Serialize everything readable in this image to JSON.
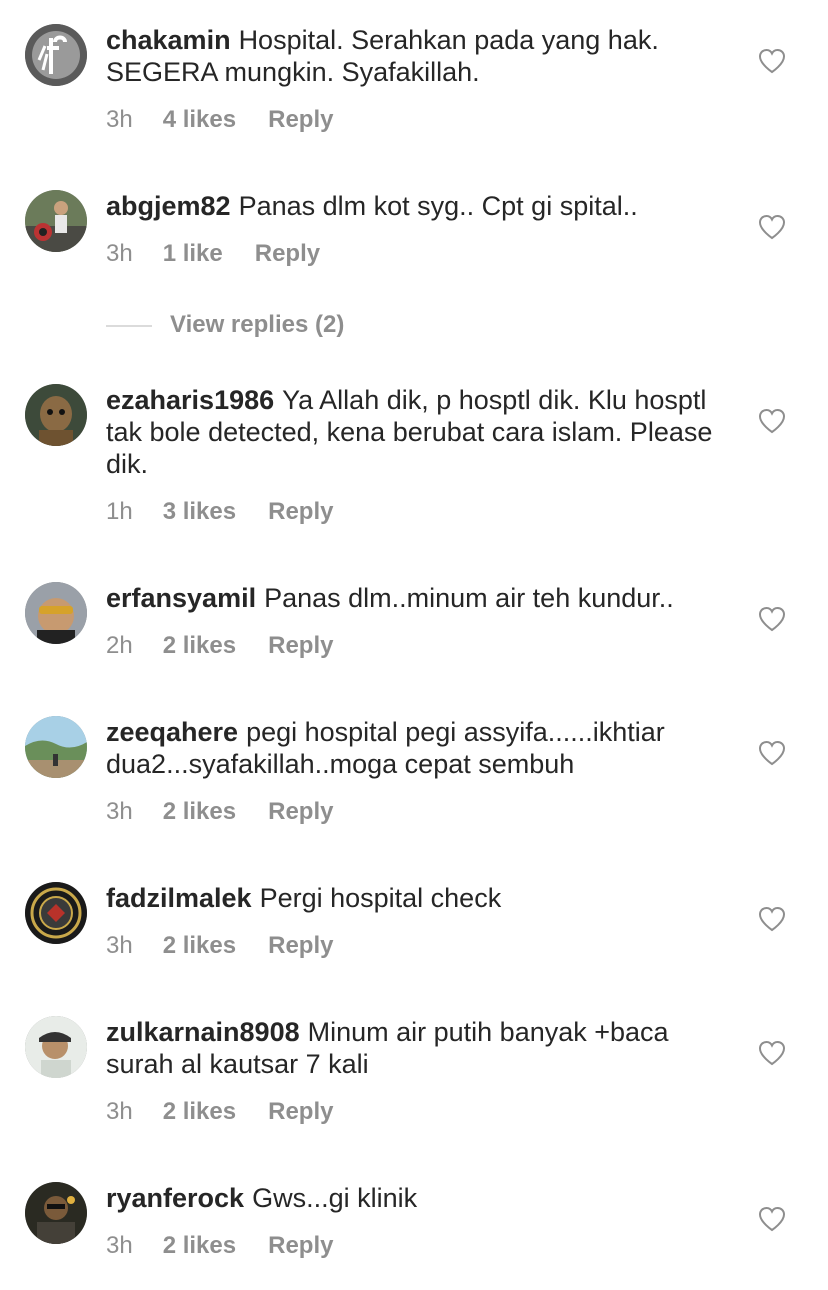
{
  "comments": [
    {
      "username": "chakamin",
      "text": "Hospital. Serahkan pada yang hak. SEGERA mungkin. Syafakillah.",
      "time": "3h",
      "likes": "4 likes",
      "reply": "Reply"
    },
    {
      "username": "abgjem82",
      "text": "Panas dlm kot syg.. Cpt gi spital..",
      "time": "3h",
      "likes": "1 like",
      "reply": "Reply"
    },
    {
      "username": "ezaharis1986",
      "text": "Ya Allah dik, p hosptl dik. Klu hosptl tak bole detected, kena berubat cara islam. Please dik.",
      "time": "1h",
      "likes": "3 likes",
      "reply": "Reply"
    },
    {
      "username": "erfansyamil",
      "text": "Panas dlm..minum air teh kundur..",
      "time": "2h",
      "likes": "2 likes",
      "reply": "Reply"
    },
    {
      "username": "zeeqahere",
      "text": "pegi hospital pegi assyifa......ikhtiar dua2...syafakillah..moga cepat sembuh",
      "time": "3h",
      "likes": "2 likes",
      "reply": "Reply"
    },
    {
      "username": "fadzilmalek",
      "text": "Pergi hospital check",
      "time": "3h",
      "likes": "2 likes",
      "reply": "Reply"
    },
    {
      "username": "zulkarnain8908",
      "text": "Minum air putih banyak +baca surah al kautsar 7 kali",
      "time": "3h",
      "likes": "2 likes",
      "reply": "Reply"
    },
    {
      "username": "ryanferock",
      "text": "Gws...gi klinik",
      "time": "3h",
      "likes": "2 likes",
      "reply": "Reply"
    }
  ],
  "view_replies": "View replies (2)",
  "icons": {
    "like": "heart-outline-icon"
  },
  "colors": {
    "text": "#262626",
    "meta": "#8e8e8e",
    "divider": "#dbdbdb"
  }
}
